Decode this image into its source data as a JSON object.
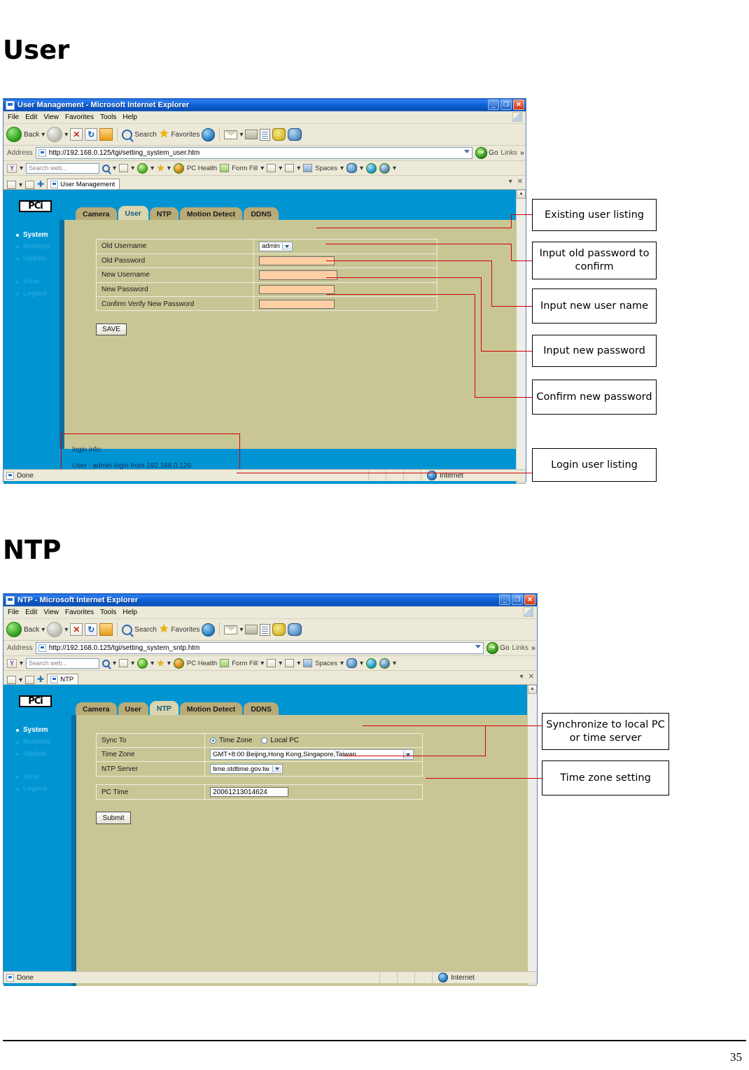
{
  "document": {
    "heading_user": "User",
    "heading_ntp": "NTP",
    "page_number": "35"
  },
  "window_user": {
    "title": "User Management - Microsoft Internet Explorer",
    "minimize": "_",
    "maximize": "❐",
    "close": "✕",
    "menu": [
      "File",
      "Edit",
      "View",
      "Favorites",
      "Tools",
      "Help"
    ],
    "toolbar": {
      "back": "Back",
      "search": "Search",
      "favorites": "Favorites"
    },
    "address": {
      "label": "Address",
      "url": "http://192.168.0.125/tgi/setting_system_user.htm",
      "go": "Go",
      "links": "Links",
      "chevron": "»"
    },
    "search_toolbar": {
      "placeholder": "Search web...",
      "pc_health": "PC Health",
      "form_fill": "Form Fill",
      "spaces": "Spaces"
    },
    "ie_tab": "User Management",
    "tab_close": "✕",
    "tab_caret": "▾",
    "status": {
      "text": "Done",
      "zone": "Internet"
    },
    "page": {
      "logo": "PCi",
      "sidebar": [
        {
          "label": "System",
          "state": "active"
        },
        {
          "label": "Network",
          "state": "dim"
        },
        {
          "label": "Update",
          "state": "dim"
        },
        {
          "label": "View",
          "state": "dim"
        },
        {
          "label": "Logout",
          "state": "dim"
        }
      ],
      "tabs": [
        {
          "label": "Camera",
          "active": false
        },
        {
          "label": "User",
          "active": true
        },
        {
          "label": "NTP",
          "active": false
        },
        {
          "label": "Motion Detect",
          "active": false
        },
        {
          "label": "DDNS",
          "active": false
        }
      ],
      "form_rows": [
        {
          "label": "Old Username",
          "type": "select",
          "value": "admin"
        },
        {
          "label": "Old Password",
          "type": "text",
          "value": ""
        },
        {
          "label": "New Username",
          "type": "text",
          "value": ""
        },
        {
          "label": "New Password",
          "type": "text",
          "value": ""
        },
        {
          "label": "Confirm Verify New Password",
          "type": "text",
          "value": ""
        }
      ],
      "save_button": "SAVE",
      "login_info_title": "login info:",
      "login_info_line": "User : admin login from 192.168.0.126"
    },
    "callouts": [
      "Existing user listing",
      "Input old password to confirm",
      "Input new user name",
      "Input new password",
      "Confirm new password",
      "Login user listing"
    ]
  },
  "window_ntp": {
    "title": "NTP - Microsoft Internet Explorer",
    "minimize": "_",
    "maximize": "❐",
    "close": "✕",
    "menu": [
      "File",
      "Edit",
      "View",
      "Favorites",
      "Tools",
      "Help"
    ],
    "toolbar": {
      "back": "Back",
      "search": "Search",
      "favorites": "Favorites"
    },
    "address": {
      "label": "Address",
      "url": "http://192.168.0.125/tgi/setting_system_sntp.htm",
      "go": "Go",
      "links": "Links",
      "chevron": "»"
    },
    "search_toolbar": {
      "placeholder": "Search web...",
      "pc_health": "PC Health",
      "form_fill": "Form Fill",
      "spaces": "Spaces"
    },
    "ie_tab": "NTP",
    "tab_close": "✕",
    "tab_caret": "▾",
    "status": {
      "text": "Done",
      "zone": "Internet"
    },
    "page": {
      "logo": "PCi",
      "sidebar": [
        {
          "label": "System",
          "state": "active"
        },
        {
          "label": "Network",
          "state": "dim"
        },
        {
          "label": "Update",
          "state": "dim"
        },
        {
          "label": "View",
          "state": "dim"
        },
        {
          "label": "Logout",
          "state": "dim"
        }
      ],
      "tabs": [
        {
          "label": "Camera",
          "active": false
        },
        {
          "label": "User",
          "active": false
        },
        {
          "label": "NTP",
          "active": true
        },
        {
          "label": "Motion Detect",
          "active": false
        },
        {
          "label": "DDNS",
          "active": false
        }
      ],
      "sync_to_label": "Sync To",
      "sync_option_timezone": "Time Zone",
      "sync_option_localpc": "Local PC",
      "sync_selected": "Time Zone",
      "time_zone_label": "Time Zone",
      "time_zone_value": "GMT+8:00 Beijing,Hong Kong,Singapore,Taiwan",
      "ntp_server_label": "NTP Server",
      "ntp_server_value": "time.stdtime.gov.tw",
      "pc_time_label": "PC Time",
      "pc_time_value": "20061213014624",
      "submit_button": "Submit"
    },
    "callouts": [
      "Synchronize to local PC or time server",
      "Time zone setting"
    ]
  },
  "colors": {
    "ie_blue": "#0b57c8",
    "page_cyan": "#0094d2",
    "panel_khaki": "#c9c696",
    "tab_khaki": "#b8ab78",
    "input_peach": "#ffcfa4",
    "annotation_red": "#d30000"
  }
}
